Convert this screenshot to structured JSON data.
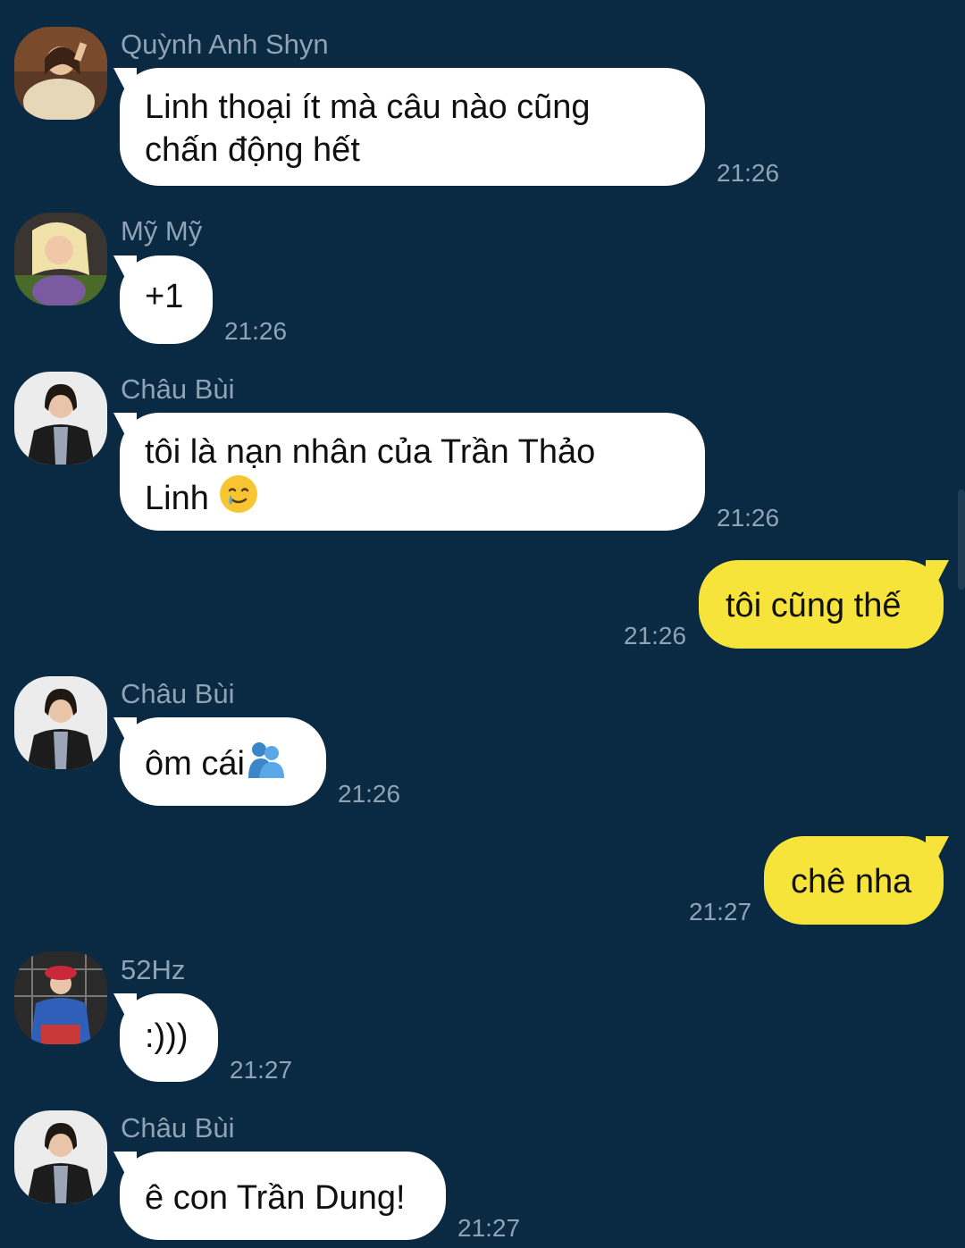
{
  "messages": [
    {
      "sender": "Quỳnh Anh Shyn",
      "text_lines": [
        "Linh thoại ít mà câu nào cũng",
        "chấn động hết"
      ],
      "time": "21:26"
    },
    {
      "sender": "Mỹ Mỹ",
      "text": "+1",
      "time": "21:26"
    },
    {
      "sender": "Châu Bùi",
      "text_lines": [
        "tôi là nạn nhân của Trần Thảo",
        "Linh"
      ],
      "emoji": "smiling-with-tear-emoji",
      "time": "21:26"
    },
    {
      "outgoing": true,
      "text": "tôi cũng thế",
      "time": "21:26"
    },
    {
      "sender": "Châu Bùi",
      "text": "ôm cái",
      "emoji": "people-hugging-emoji",
      "time": "21:26"
    },
    {
      "outgoing": true,
      "text": "chê nha",
      "time": "21:27"
    },
    {
      "sender": "52Hz",
      "text": ":)))",
      "time": "21:27"
    },
    {
      "sender": "Châu Bùi",
      "text": "ê con Trần Dung!",
      "time": "21:27"
    }
  ],
  "colors": {
    "background": "#0a2942",
    "incoming_bubble": "#ffffff",
    "outgoing_bubble": "#f7e43a",
    "meta_text": "#8fa3b5"
  }
}
